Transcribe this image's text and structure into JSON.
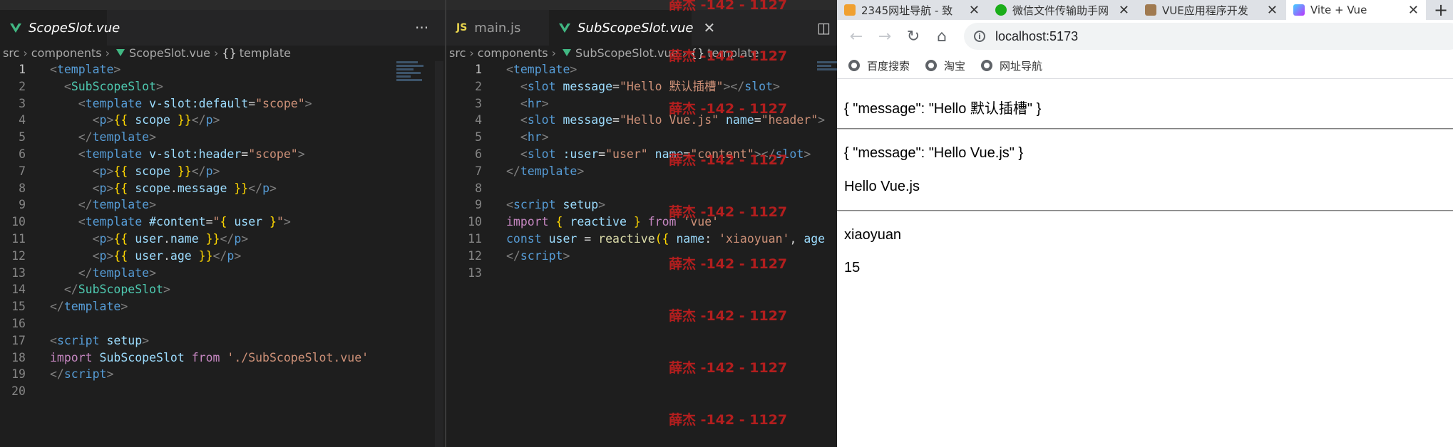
{
  "editor": {
    "left_pane": {
      "tab_label": "ScopeSlot.vue",
      "more_actions": "···",
      "breadcrumb": [
        "src",
        "components",
        "ScopeSlot.vue",
        "template"
      ],
      "lines": [
        [
          [
            "t-punc",
            "<"
          ],
          [
            "t-tag",
            "template"
          ],
          [
            "t-punc",
            ">"
          ]
        ],
        [
          [
            "",
            "  "
          ],
          [
            "t-punc",
            "<"
          ],
          [
            "t-cls",
            "SubScopeSlot"
          ],
          [
            "t-punc",
            ">"
          ]
        ],
        [
          [
            "",
            "    "
          ],
          [
            "t-punc",
            "<"
          ],
          [
            "t-tag",
            "template"
          ],
          [
            "",
            " "
          ],
          [
            "t-attr",
            "v-slot:default"
          ],
          [
            "",
            "="
          ],
          [
            "t-str",
            "\"scope\""
          ],
          [
            "t-punc",
            ">"
          ]
        ],
        [
          [
            "",
            "      "
          ],
          [
            "t-punc",
            "<"
          ],
          [
            "t-tag",
            "p"
          ],
          [
            "t-punc",
            ">"
          ],
          [
            "t-br",
            "{{"
          ],
          [
            "",
            " "
          ],
          [
            "t-var",
            "scope"
          ],
          [
            "",
            " "
          ],
          [
            "t-br",
            "}}"
          ],
          [
            "t-punc",
            "</"
          ],
          [
            "t-tag",
            "p"
          ],
          [
            "t-punc",
            ">"
          ]
        ],
        [
          [
            "",
            "    "
          ],
          [
            "t-punc",
            "</"
          ],
          [
            "t-tag",
            "template"
          ],
          [
            "t-punc",
            ">"
          ]
        ],
        [
          [
            "",
            "    "
          ],
          [
            "t-punc",
            "<"
          ],
          [
            "t-tag",
            "template"
          ],
          [
            "",
            " "
          ],
          [
            "t-attr",
            "v-slot:header"
          ],
          [
            "",
            "="
          ],
          [
            "t-str",
            "\"scope\""
          ],
          [
            "t-punc",
            ">"
          ]
        ],
        [
          [
            "",
            "      "
          ],
          [
            "t-punc",
            "<"
          ],
          [
            "t-tag",
            "p"
          ],
          [
            "t-punc",
            ">"
          ],
          [
            "t-br",
            "{{"
          ],
          [
            "",
            " "
          ],
          [
            "t-var",
            "scope"
          ],
          [
            "",
            " "
          ],
          [
            "t-br",
            "}}"
          ],
          [
            "t-punc",
            "</"
          ],
          [
            "t-tag",
            "p"
          ],
          [
            "t-punc",
            ">"
          ]
        ],
        [
          [
            "",
            "      "
          ],
          [
            "t-punc",
            "<"
          ],
          [
            "t-tag",
            "p"
          ],
          [
            "t-punc",
            ">"
          ],
          [
            "t-br",
            "{{"
          ],
          [
            "",
            " "
          ],
          [
            "t-var",
            "scope"
          ],
          [
            "",
            "."
          ],
          [
            "t-var",
            "message"
          ],
          [
            "",
            " "
          ],
          [
            "t-br",
            "}}"
          ],
          [
            "t-punc",
            "</"
          ],
          [
            "t-tag",
            "p"
          ],
          [
            "t-punc",
            ">"
          ]
        ],
        [
          [
            "",
            "    "
          ],
          [
            "t-punc",
            "</"
          ],
          [
            "t-tag",
            "template"
          ],
          [
            "t-punc",
            ">"
          ]
        ],
        [
          [
            "",
            "    "
          ],
          [
            "t-punc",
            "<"
          ],
          [
            "t-tag",
            "template"
          ],
          [
            "",
            " "
          ],
          [
            "t-attr",
            "#content"
          ],
          [
            "",
            "="
          ],
          [
            "t-str",
            "\""
          ],
          [
            "t-br",
            "{"
          ],
          [
            "",
            " "
          ],
          [
            "t-var",
            "user"
          ],
          [
            "",
            " "
          ],
          [
            "t-br",
            "}"
          ],
          [
            "t-str",
            "\""
          ],
          [
            "t-punc",
            ">"
          ]
        ],
        [
          [
            "",
            "      "
          ],
          [
            "t-punc",
            "<"
          ],
          [
            "t-tag",
            "p"
          ],
          [
            "t-punc",
            ">"
          ],
          [
            "t-br",
            "{{"
          ],
          [
            "",
            " "
          ],
          [
            "t-var",
            "user"
          ],
          [
            "",
            "."
          ],
          [
            "t-var",
            "name"
          ],
          [
            "",
            " "
          ],
          [
            "t-br",
            "}}"
          ],
          [
            "t-punc",
            "</"
          ],
          [
            "t-tag",
            "p"
          ],
          [
            "t-punc",
            ">"
          ]
        ],
        [
          [
            "",
            "      "
          ],
          [
            "t-punc",
            "<"
          ],
          [
            "t-tag",
            "p"
          ],
          [
            "t-punc",
            ">"
          ],
          [
            "t-br",
            "{{"
          ],
          [
            "",
            " "
          ],
          [
            "t-var",
            "user"
          ],
          [
            "",
            "."
          ],
          [
            "t-var",
            "age"
          ],
          [
            "",
            " "
          ],
          [
            "t-br",
            "}}"
          ],
          [
            "t-punc",
            "</"
          ],
          [
            "t-tag",
            "p"
          ],
          [
            "t-punc",
            ">"
          ]
        ],
        [
          [
            "",
            "    "
          ],
          [
            "t-punc",
            "</"
          ],
          [
            "t-tag",
            "template"
          ],
          [
            "t-punc",
            ">"
          ]
        ],
        [
          [
            "",
            "  "
          ],
          [
            "t-punc",
            "</"
          ],
          [
            "t-cls",
            "SubScopeSlot"
          ],
          [
            "t-punc",
            ">"
          ]
        ],
        [
          [
            "t-punc",
            "</"
          ],
          [
            "t-tag",
            "template"
          ],
          [
            "t-punc",
            ">"
          ]
        ],
        [],
        [
          [
            "t-punc",
            "<"
          ],
          [
            "t-tag",
            "script"
          ],
          [
            "",
            " "
          ],
          [
            "t-attr",
            "setup"
          ],
          [
            "t-punc",
            ">"
          ]
        ],
        [
          [
            "t-kw",
            "import"
          ],
          [
            "",
            " "
          ],
          [
            "t-var",
            "SubScopeSlot"
          ],
          [
            "",
            " "
          ],
          [
            "t-kw",
            "from"
          ],
          [
            "",
            " "
          ],
          [
            "t-str",
            "'./SubScopeSlot.vue'"
          ]
        ],
        [
          [
            "t-punc",
            "</"
          ],
          [
            "t-tag",
            "script"
          ],
          [
            "t-punc",
            ">"
          ]
        ],
        []
      ]
    },
    "right_pane": {
      "tabs": [
        {
          "label": "main.js",
          "type": "js",
          "js_badge": "JS",
          "active": false
        },
        {
          "label": "SubScopeSlot.vue",
          "type": "vue",
          "active": true,
          "close": "✕"
        }
      ],
      "split_icon": "◫",
      "breadcrumb": [
        "src",
        "components",
        "SubScopeSlot.vue",
        "template"
      ],
      "lines": [
        [
          [
            "t-punc",
            "<"
          ],
          [
            "t-tag",
            "template"
          ],
          [
            "t-punc",
            ">"
          ]
        ],
        [
          [
            "",
            "  "
          ],
          [
            "t-punc",
            "<"
          ],
          [
            "t-tag",
            "slot"
          ],
          [
            "",
            " "
          ],
          [
            "t-attr",
            "message"
          ],
          [
            "",
            "="
          ],
          [
            "t-str",
            "\"Hello 默认插槽\""
          ],
          [
            "t-punc",
            "></"
          ],
          [
            "t-tag",
            "slot"
          ],
          [
            "t-punc",
            ">"
          ]
        ],
        [
          [
            "",
            "  "
          ],
          [
            "t-punc",
            "<"
          ],
          [
            "t-tag",
            "hr"
          ],
          [
            "t-punc",
            ">"
          ]
        ],
        [
          [
            "",
            "  "
          ],
          [
            "t-punc",
            "<"
          ],
          [
            "t-tag",
            "slot"
          ],
          [
            "",
            " "
          ],
          [
            "t-attr",
            "message"
          ],
          [
            "",
            "="
          ],
          [
            "t-str",
            "\"Hello Vue.js\""
          ],
          [
            "",
            " "
          ],
          [
            "t-attr",
            "name"
          ],
          [
            "",
            "="
          ],
          [
            "t-str",
            "\"header\""
          ],
          [
            "t-punc",
            ">"
          ]
        ],
        [
          [
            "",
            "  "
          ],
          [
            "t-punc",
            "<"
          ],
          [
            "t-tag",
            "hr"
          ],
          [
            "t-punc",
            ">"
          ]
        ],
        [
          [
            "",
            "  "
          ],
          [
            "t-punc",
            "<"
          ],
          [
            "t-tag",
            "slot"
          ],
          [
            "",
            " "
          ],
          [
            "t-attr",
            ":user"
          ],
          [
            "",
            "="
          ],
          [
            "t-str",
            "\"user\""
          ],
          [
            "",
            " "
          ],
          [
            "t-attr",
            "name"
          ],
          [
            "",
            "="
          ],
          [
            "t-str",
            "\"content\""
          ],
          [
            "t-punc",
            "></"
          ],
          [
            "t-tag",
            "slot"
          ],
          [
            "t-punc",
            ">"
          ]
        ],
        [
          [
            "t-punc",
            "</"
          ],
          [
            "t-tag",
            "template"
          ],
          [
            "t-punc",
            ">"
          ]
        ],
        [],
        [
          [
            "t-punc",
            "<"
          ],
          [
            "t-tag",
            "script"
          ],
          [
            "",
            " "
          ],
          [
            "t-attr",
            "setup"
          ],
          [
            "t-punc",
            ">"
          ]
        ],
        [
          [
            "t-kw",
            "import"
          ],
          [
            "",
            " "
          ],
          [
            "t-br",
            "{"
          ],
          [
            "",
            " "
          ],
          [
            "t-var",
            "reactive"
          ],
          [
            "",
            " "
          ],
          [
            "t-br",
            "}"
          ],
          [
            "",
            " "
          ],
          [
            "t-kw",
            "from"
          ],
          [
            "",
            " "
          ],
          [
            "t-str",
            "'vue'"
          ]
        ],
        [
          [
            "t-kw2",
            "const"
          ],
          [
            "",
            " "
          ],
          [
            "t-var",
            "user"
          ],
          [
            "",
            " = "
          ],
          [
            "t-fn",
            "reactive"
          ],
          [
            "t-br",
            "("
          ],
          [
            "t-br",
            "{"
          ],
          [
            "",
            " "
          ],
          [
            "t-var",
            "name"
          ],
          [
            "",
            ": "
          ],
          [
            "t-str",
            "'xiaoyuan'"
          ],
          [
            "",
            ", "
          ],
          [
            "t-var",
            "age"
          ]
        ],
        [
          [
            "t-punc",
            "</"
          ],
          [
            "t-tag",
            "script"
          ],
          [
            "t-punc",
            ">"
          ]
        ],
        []
      ]
    },
    "watermark": "薛杰 -142 - 1127"
  },
  "browser": {
    "tabs": [
      {
        "label": "2345网址导航 - 致",
        "close": "✕"
      },
      {
        "label": "微信文件传输助手网",
        "close": "✕"
      },
      {
        "label": "VUE应用程序开发",
        "close": "✕"
      },
      {
        "label": "Vite + Vue",
        "close": "✕",
        "active": true
      }
    ],
    "new_tab": "+",
    "nav": {
      "back": "←",
      "forward": "→",
      "reload": "↻",
      "home": "⌂"
    },
    "address": "localhost:5173",
    "info_icon": "i",
    "bookmarks": [
      "百度搜索",
      "淘宝",
      "网址导航"
    ],
    "content": {
      "slot_default": "{ \"message\": \"Hello 默认插槽\" }",
      "slot_header_scope": "{ \"message\": \"Hello Vue.js\" }",
      "slot_header_message": "Hello Vue.js",
      "user_name": "xiaoyuan",
      "user_age": "15"
    }
  }
}
